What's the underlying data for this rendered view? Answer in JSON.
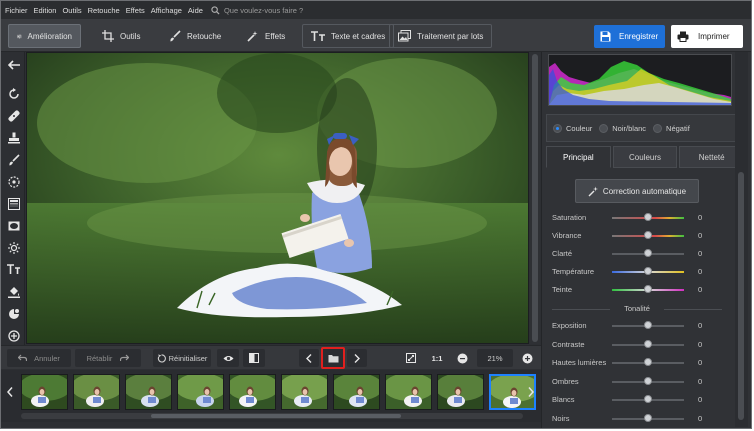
{
  "menu": {
    "items": [
      "Fichier",
      "Edition",
      "Outils",
      "Retouche",
      "Effets",
      "Affichage",
      "Aide"
    ],
    "search_placeholder": "Que voulez-vous faire ?"
  },
  "toolbar": {
    "tabs": [
      {
        "label": "Amélioration",
        "icon": "sliders-icon",
        "active": true
      },
      {
        "label": "Outils",
        "icon": "crop-icon",
        "active": false
      },
      {
        "label": "Retouche",
        "icon": "brush-icon",
        "active": false
      },
      {
        "label": "Effets",
        "icon": "magic-wand-icon",
        "active": false
      },
      {
        "label": "Texte et cadres",
        "icon": "text-icon",
        "active": false
      },
      {
        "label": "Traitement par lots",
        "icon": "batch-icon",
        "active": false
      }
    ],
    "save_label": "Enregistrer",
    "print_label": "Imprimer"
  },
  "bottombar": {
    "undo": "Annuler",
    "redo": "Rétablir",
    "reset": "Réinitialiser",
    "zoom_ratio": "1:1",
    "zoom_level": "21%"
  },
  "right_panel": {
    "mode_options": [
      {
        "label": "Couleur",
        "selected": true
      },
      {
        "label": "Noir/blanc",
        "selected": false
      },
      {
        "label": "Négatif",
        "selected": false
      }
    ],
    "tabs": [
      {
        "label": "Principal",
        "active": true
      },
      {
        "label": "Couleurs",
        "active": false
      },
      {
        "label": "Netteté",
        "active": false
      }
    ],
    "auto_correction": "Correction automatique",
    "sliders": [
      {
        "label": "Saturation",
        "value": "0",
        "gradient": "sat"
      },
      {
        "label": "Vibrance",
        "value": "0",
        "gradient": "sat"
      },
      {
        "label": "Clarté",
        "value": "0",
        "gradient": "none"
      },
      {
        "label": "Température",
        "value": "0",
        "gradient": "temp"
      },
      {
        "label": "Teinte",
        "value": "0",
        "gradient": "tint"
      }
    ],
    "section_label": "Tonalité",
    "tone_sliders": [
      {
        "label": "Exposition",
        "value": "0"
      },
      {
        "label": "Contraste",
        "value": "0"
      },
      {
        "label": "Hautes lumières",
        "value": "0"
      },
      {
        "label": "Ombres",
        "value": "0"
      },
      {
        "label": "Blancs",
        "value": "0"
      },
      {
        "label": "Noirs",
        "value": "0"
      }
    ]
  },
  "colors": {
    "accent": "#1e70d8",
    "highlight": "#e0201e",
    "selected_thumb": "#1e82ff"
  },
  "filmstrip_count": 10,
  "selected_thumb_index": 9
}
